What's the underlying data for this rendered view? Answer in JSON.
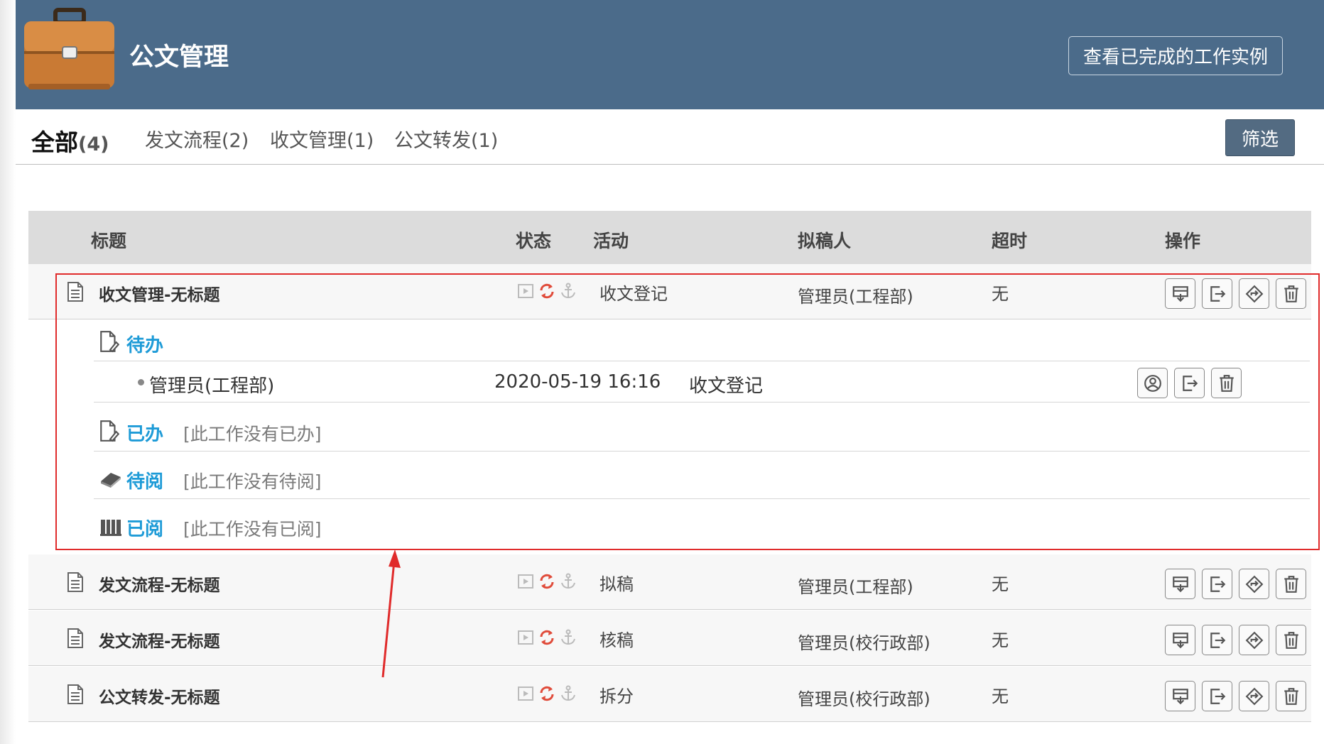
{
  "header": {
    "title": "公文管理",
    "completed_button": "查看已完成的工作实例"
  },
  "tabs": {
    "all_label": "全部",
    "all_count": "(4)",
    "items": [
      "发文流程(2)",
      "收文管理(1)",
      "公文转发(1)"
    ],
    "filter_button": "筛选"
  },
  "table": {
    "headers": {
      "title": "标题",
      "status": "状态",
      "activity": "活动",
      "drafter": "拟稿人",
      "timeout": "超时",
      "actions": "操作"
    },
    "rows": [
      {
        "title": "收文管理-无标题",
        "activity": "收文登记",
        "drafter": "管理员(工程部)",
        "timeout": "无"
      },
      {
        "title": "发文流程-无标题",
        "activity": "拟稿",
        "drafter": "管理员(工程部)",
        "timeout": "无"
      },
      {
        "title": "发文流程-无标题",
        "activity": "核稿",
        "drafter": "管理员(校行政部)",
        "timeout": "无"
      },
      {
        "title": "公文转发-无标题",
        "activity": "拆分",
        "drafter": "管理员(校行政部)",
        "timeout": "无"
      }
    ]
  },
  "detail": {
    "todo_label": "待办",
    "todo_item": {
      "person": "管理员(工程部)",
      "time": "2020-05-19 16:16",
      "activity": "收文登记"
    },
    "done_label": "已办",
    "done_empty": "[此工作没有已办]",
    "toread_label": "待阅",
    "toread_empty": "[此工作没有待阅]",
    "read_label": "已阅",
    "read_empty": "[此工作没有已阅]"
  },
  "colors": {
    "header_bg": "#4b6b8a",
    "accent_blue": "#1e9bd7",
    "highlight_red": "#e02b2b",
    "status_refresh_red": "#e04b3a"
  }
}
